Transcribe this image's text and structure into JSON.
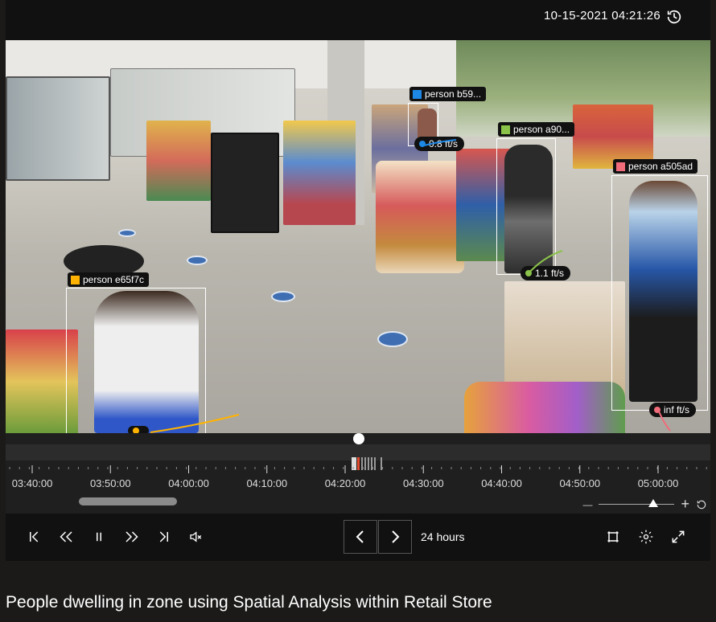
{
  "header": {
    "timestamp": "10-15-2021 04:21:26",
    "history_icon": "history-icon"
  },
  "detections": [
    {
      "label": "person b59...",
      "color": "#1e88e5",
      "speed": "0.8 ft/s"
    },
    {
      "label": "person a90...",
      "color": "#8bc34a",
      "speed": "1.1 ft/s"
    },
    {
      "label": "person a505ad",
      "color": "#f06c7a",
      "speed": "inf ft/s"
    },
    {
      "label": "person e65f7c",
      "color": "#ffb300",
      "speed": ""
    }
  ],
  "timeline": {
    "ticks": [
      "03:40:00",
      "03:50:00",
      "04:00:00",
      "04:10:00",
      "04:20:00",
      "04:30:00",
      "04:40:00",
      "04:50:00",
      "05:00:00"
    ],
    "zoom_out": "—",
    "zoom_in": "+"
  },
  "controls": {
    "range_label": "24 hours",
    "icons": [
      "skip-to-start-icon",
      "rewind-icon",
      "pause-icon",
      "fast-forward-icon",
      "skip-to-end-icon",
      "mute-icon",
      "previous-icon",
      "next-icon",
      "zone-icon",
      "settings-icon",
      "fullscreen-icon"
    ]
  },
  "caption": "People dwelling in zone using Spatial Analysis within Retail Store"
}
